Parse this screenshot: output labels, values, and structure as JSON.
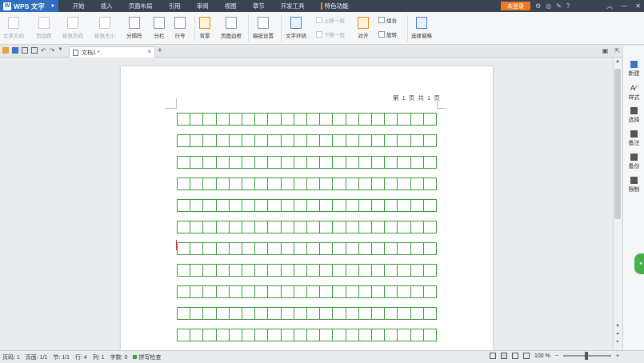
{
  "app": {
    "name": "WPS 文字"
  },
  "menu": [
    "开始",
    "插入",
    "页面布局",
    "引用",
    "审阅",
    "视图",
    "章节",
    "开发工具",
    "特色功能"
  ],
  "login_label": "未登录",
  "title_icons": [
    "⚙",
    "◎",
    "✎",
    "?"
  ],
  "ribbon": {
    "text_direction": "文字方向",
    "margins": "页边距",
    "orientation": "纸张方向",
    "size": "纸张大小",
    "separator": "分隔符",
    "columns": "分栏",
    "line_numbers": "行号",
    "background": "背景",
    "page_border": "页面边框",
    "paper_setup": "稿纸设置",
    "text_wrap": "文字环绕",
    "bring_forward": "上移一层",
    "send_backward": "下移一层",
    "align": "对齐",
    "group": "组合",
    "rotate": "旋转",
    "select_pane": "选择窗格"
  },
  "tabs": {
    "document": "文档1 *",
    "close": "×",
    "new": "+"
  },
  "page": {
    "header": "第 1 页 共 1 页"
  },
  "side_panel": [
    "新建",
    "样式",
    "选择",
    "备注",
    "备份",
    "限制"
  ],
  "status": {
    "page_no": "页码: 1",
    "pages": "页面: 1/1",
    "section": "节: 1/1",
    "row": "行: 4",
    "col": "列: 1",
    "words": "字数: 0",
    "spell": "拼写检查",
    "zoom": "100 %"
  }
}
